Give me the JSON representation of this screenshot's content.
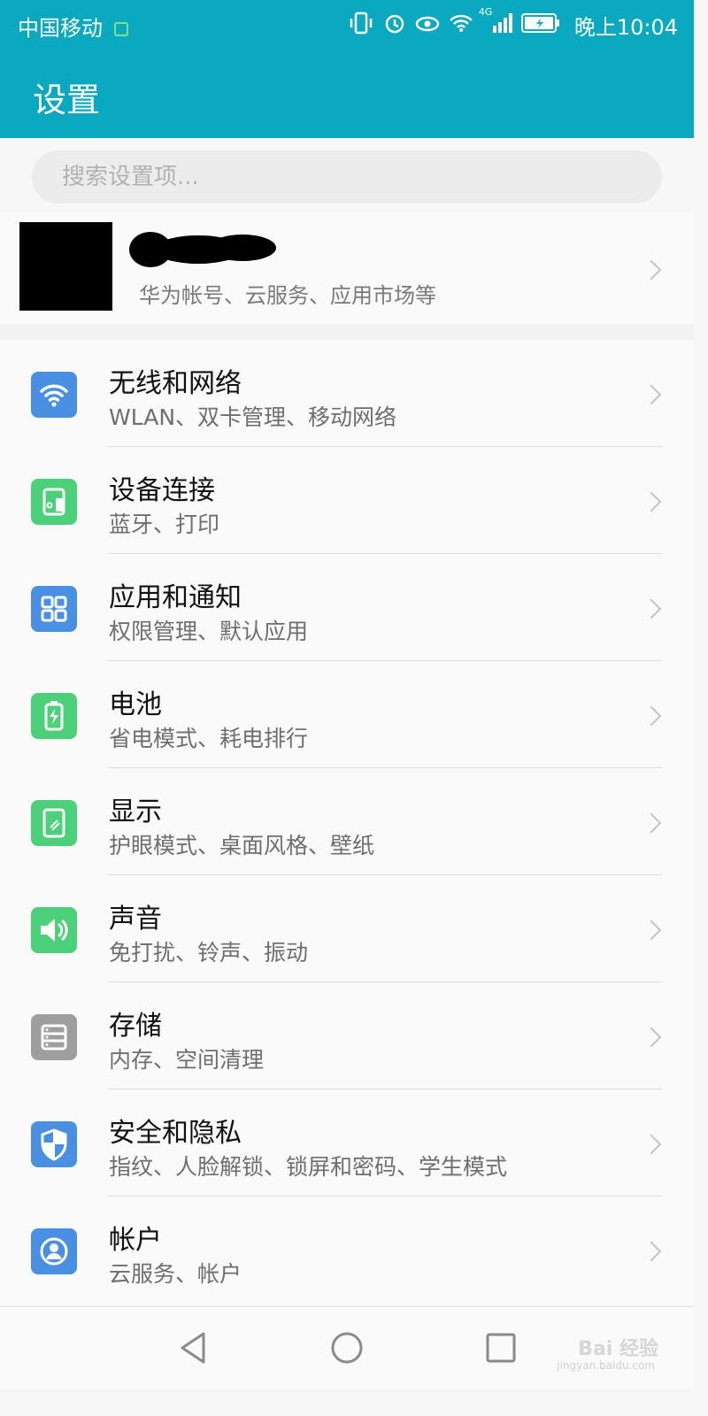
{
  "status_bar": {
    "carrier": "中国移动",
    "network_badge": "4G",
    "time": "晚上10:04",
    "icons": [
      "sim-icon",
      "vibrate-icon",
      "alarm-icon",
      "eye-comfort-icon",
      "wifi-icon",
      "signal-icon",
      "battery-icon"
    ]
  },
  "header": {
    "title": "设置"
  },
  "search": {
    "placeholder": "搜索设置项..."
  },
  "account": {
    "subtitle": "华为帐号、云服务、应用市场等"
  },
  "settings": [
    {
      "label": "无线和网络",
      "desc": "WLAN、双卡管理、移动网络",
      "icon": "wifi-icon",
      "color": "#4a90e2"
    },
    {
      "label": "设备连接",
      "desc": "蓝牙、打印",
      "icon": "device-connect-icon",
      "color": "#4cd07a"
    },
    {
      "label": "应用和通知",
      "desc": "权限管理、默认应用",
      "icon": "apps-grid-icon",
      "color": "#4a90e2"
    },
    {
      "label": "电池",
      "desc": "省电模式、耗电排行",
      "icon": "battery-icon",
      "color": "#4cd07a"
    },
    {
      "label": "显示",
      "desc": "护眼模式、桌面风格、壁纸",
      "icon": "display-icon",
      "color": "#4cd07a"
    },
    {
      "label": "声音",
      "desc": "免打扰、铃声、振动",
      "icon": "speaker-icon",
      "color": "#4cd07a"
    },
    {
      "label": "存储",
      "desc": "内存、空间清理",
      "icon": "storage-icon",
      "color": "#9e9e9e"
    },
    {
      "label": "安全和隐私",
      "desc": "指纹、人脸解锁、锁屏和密码、学生模式",
      "icon": "shield-icon",
      "color": "#4a90e2"
    },
    {
      "label": "帐户",
      "desc": "云服务、帐户",
      "icon": "account-icon",
      "color": "#4a90e2"
    }
  ],
  "nav": {
    "icons": [
      "back-icon",
      "home-icon",
      "recents-icon"
    ]
  },
  "watermark": {
    "text": "Bai 经验",
    "sub": "jingyan.baidu.com"
  },
  "colors": {
    "header": "#0aa9c0",
    "blue_icon": "#4a90e2",
    "green_icon": "#4cd07a",
    "gray_icon": "#9e9e9e"
  }
}
